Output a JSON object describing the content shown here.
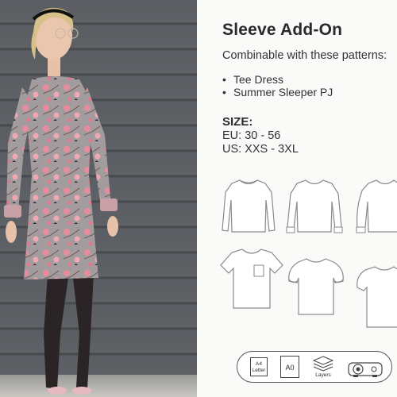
{
  "product": {
    "title": "Sleeve Add-On",
    "subtitle": "Combinable with these patterns:",
    "patterns": [
      "Tee Dress",
      "Summer Sleeper PJ"
    ],
    "bullet": "•",
    "size_heading": "SIZE:",
    "size_eu": "EU: 30 - 56",
    "size_us": "US: XXS - 3XL"
  },
  "garments": [
    {
      "name": "long-sleeve-fitted"
    },
    {
      "name": "long-sleeve-cuffed"
    },
    {
      "name": "long-sleeve-puffed"
    },
    {
      "name": "short-sleeve-pocket"
    },
    {
      "name": "short-sleeve-puff"
    },
    {
      "name": "short-sleeve-gathered"
    }
  ],
  "formats": {
    "a4_line1": "A4",
    "a4_line2": "Letter",
    "a0": "A0",
    "layers": "Layers",
    "projector_icon": "projector-icon"
  },
  "colors": {
    "panel_bg": "#fafaf8",
    "dress_base": "#9a9396",
    "flower_pink": "#e58a9a",
    "wall_gray": "#5a5d61"
  }
}
